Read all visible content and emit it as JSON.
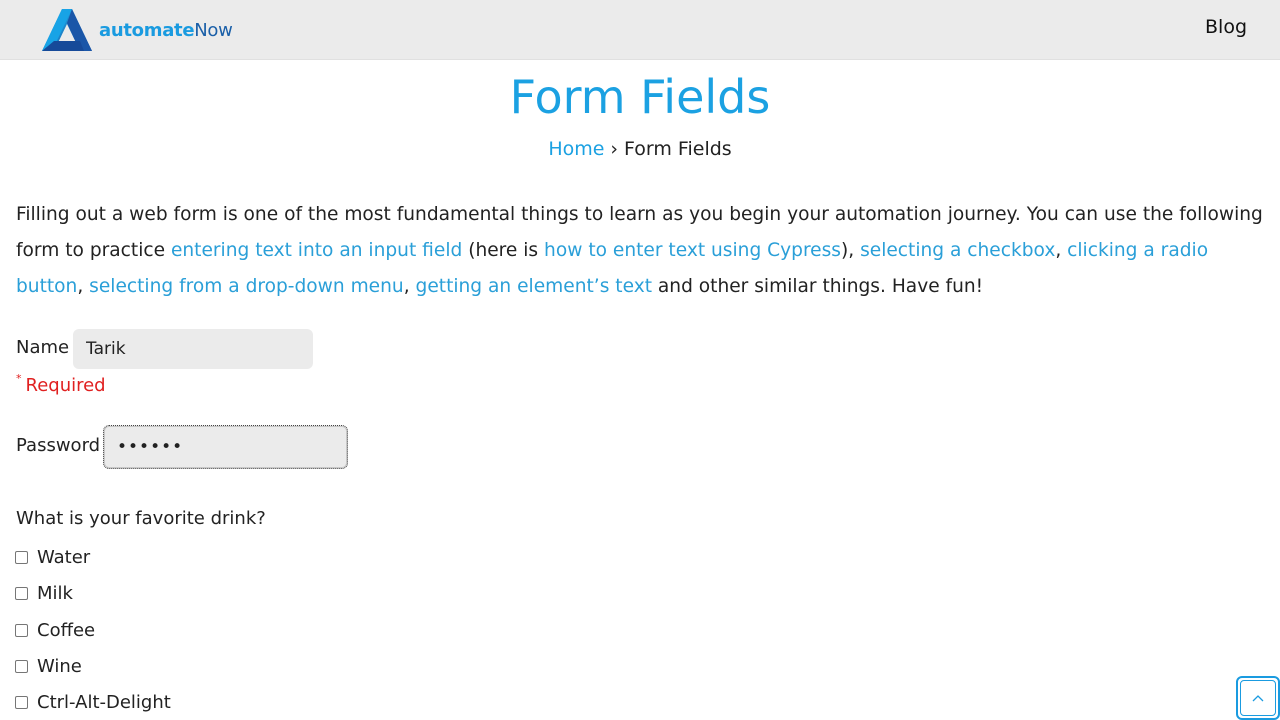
{
  "header": {
    "logo_text_bold": "automate",
    "logo_text_light": "Now",
    "nav_blog": "Blog"
  },
  "page": {
    "title": "Form Fields",
    "breadcrumb_home": "Home",
    "breadcrumb_sep": "›",
    "breadcrumb_current": "Form Fields"
  },
  "intro": {
    "t1": "Filling out a web form is one of the most fundamental things to learn as you begin your automation journey. You can use the following form to practice ",
    "l1": "entering text into an input field",
    "t2": " (here is ",
    "l2": "how to enter text using Cypress",
    "t3": "), ",
    "l3": "selecting a checkbox",
    "t4": ", ",
    "l4": "clicking a radio button",
    "t5": ", ",
    "l5": "selecting from a drop-down menu",
    "t6": ", ",
    "l6": "getting an element’s text",
    "t7": " and other similar things. Have fun!"
  },
  "form": {
    "name_label": "Name",
    "name_value": "Tarik",
    "required_mark": "*",
    "required_text": "Required",
    "password_label": "Password",
    "password_value": "••••••",
    "drink_question": "What is your favorite drink?",
    "drinks": [
      "Water",
      "Milk",
      "Coffee",
      "Wine",
      "Ctrl-Alt-Delight"
    ]
  },
  "scroll_top": {
    "icon": "chevron-up-icon",
    "glyph": "^"
  },
  "colors": {
    "accent": "#1ba1e2",
    "required": "#e02020",
    "header_bg": "#ebebeb"
  }
}
